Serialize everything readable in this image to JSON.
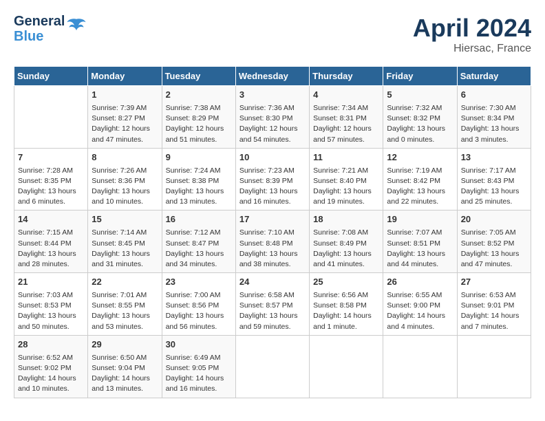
{
  "header": {
    "logo_line1": "General",
    "logo_line2": "Blue",
    "month": "April 2024",
    "location": "Hiersac, France"
  },
  "columns": [
    "Sunday",
    "Monday",
    "Tuesday",
    "Wednesday",
    "Thursday",
    "Friday",
    "Saturday"
  ],
  "rows": [
    [
      {
        "day": "",
        "info": ""
      },
      {
        "day": "1",
        "info": "Sunrise: 7:39 AM\nSunset: 8:27 PM\nDaylight: 12 hours\nand 47 minutes."
      },
      {
        "day": "2",
        "info": "Sunrise: 7:38 AM\nSunset: 8:29 PM\nDaylight: 12 hours\nand 51 minutes."
      },
      {
        "day": "3",
        "info": "Sunrise: 7:36 AM\nSunset: 8:30 PM\nDaylight: 12 hours\nand 54 minutes."
      },
      {
        "day": "4",
        "info": "Sunrise: 7:34 AM\nSunset: 8:31 PM\nDaylight: 12 hours\nand 57 minutes."
      },
      {
        "day": "5",
        "info": "Sunrise: 7:32 AM\nSunset: 8:32 PM\nDaylight: 13 hours\nand 0 minutes."
      },
      {
        "day": "6",
        "info": "Sunrise: 7:30 AM\nSunset: 8:34 PM\nDaylight: 13 hours\nand 3 minutes."
      }
    ],
    [
      {
        "day": "7",
        "info": "Sunrise: 7:28 AM\nSunset: 8:35 PM\nDaylight: 13 hours\nand 6 minutes."
      },
      {
        "day": "8",
        "info": "Sunrise: 7:26 AM\nSunset: 8:36 PM\nDaylight: 13 hours\nand 10 minutes."
      },
      {
        "day": "9",
        "info": "Sunrise: 7:24 AM\nSunset: 8:38 PM\nDaylight: 13 hours\nand 13 minutes."
      },
      {
        "day": "10",
        "info": "Sunrise: 7:23 AM\nSunset: 8:39 PM\nDaylight: 13 hours\nand 16 minutes."
      },
      {
        "day": "11",
        "info": "Sunrise: 7:21 AM\nSunset: 8:40 PM\nDaylight: 13 hours\nand 19 minutes."
      },
      {
        "day": "12",
        "info": "Sunrise: 7:19 AM\nSunset: 8:42 PM\nDaylight: 13 hours\nand 22 minutes."
      },
      {
        "day": "13",
        "info": "Sunrise: 7:17 AM\nSunset: 8:43 PM\nDaylight: 13 hours\nand 25 minutes."
      }
    ],
    [
      {
        "day": "14",
        "info": "Sunrise: 7:15 AM\nSunset: 8:44 PM\nDaylight: 13 hours\nand 28 minutes."
      },
      {
        "day": "15",
        "info": "Sunrise: 7:14 AM\nSunset: 8:45 PM\nDaylight: 13 hours\nand 31 minutes."
      },
      {
        "day": "16",
        "info": "Sunrise: 7:12 AM\nSunset: 8:47 PM\nDaylight: 13 hours\nand 34 minutes."
      },
      {
        "day": "17",
        "info": "Sunrise: 7:10 AM\nSunset: 8:48 PM\nDaylight: 13 hours\nand 38 minutes."
      },
      {
        "day": "18",
        "info": "Sunrise: 7:08 AM\nSunset: 8:49 PM\nDaylight: 13 hours\nand 41 minutes."
      },
      {
        "day": "19",
        "info": "Sunrise: 7:07 AM\nSunset: 8:51 PM\nDaylight: 13 hours\nand 44 minutes."
      },
      {
        "day": "20",
        "info": "Sunrise: 7:05 AM\nSunset: 8:52 PM\nDaylight: 13 hours\nand 47 minutes."
      }
    ],
    [
      {
        "day": "21",
        "info": "Sunrise: 7:03 AM\nSunset: 8:53 PM\nDaylight: 13 hours\nand 50 minutes."
      },
      {
        "day": "22",
        "info": "Sunrise: 7:01 AM\nSunset: 8:55 PM\nDaylight: 13 hours\nand 53 minutes."
      },
      {
        "day": "23",
        "info": "Sunrise: 7:00 AM\nSunset: 8:56 PM\nDaylight: 13 hours\nand 56 minutes."
      },
      {
        "day": "24",
        "info": "Sunrise: 6:58 AM\nSunset: 8:57 PM\nDaylight: 13 hours\nand 59 minutes."
      },
      {
        "day": "25",
        "info": "Sunrise: 6:56 AM\nSunset: 8:58 PM\nDaylight: 14 hours\nand 1 minute."
      },
      {
        "day": "26",
        "info": "Sunrise: 6:55 AM\nSunset: 9:00 PM\nDaylight: 14 hours\nand 4 minutes."
      },
      {
        "day": "27",
        "info": "Sunrise: 6:53 AM\nSunset: 9:01 PM\nDaylight: 14 hours\nand 7 minutes."
      }
    ],
    [
      {
        "day": "28",
        "info": "Sunrise: 6:52 AM\nSunset: 9:02 PM\nDaylight: 14 hours\nand 10 minutes."
      },
      {
        "day": "29",
        "info": "Sunrise: 6:50 AM\nSunset: 9:04 PM\nDaylight: 14 hours\nand 13 minutes."
      },
      {
        "day": "30",
        "info": "Sunrise: 6:49 AM\nSunset: 9:05 PM\nDaylight: 14 hours\nand 16 minutes."
      },
      {
        "day": "",
        "info": ""
      },
      {
        "day": "",
        "info": ""
      },
      {
        "day": "",
        "info": ""
      },
      {
        "day": "",
        "info": ""
      }
    ]
  ]
}
